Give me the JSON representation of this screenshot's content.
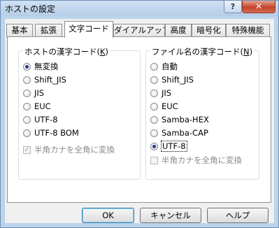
{
  "window": {
    "title": "ホストの設定",
    "help_label": "?",
    "close_label": "✕"
  },
  "tabs": [
    {
      "label": "基本"
    },
    {
      "label": "拡張"
    },
    {
      "label": "文字コード"
    },
    {
      "label": "ダイアルアップ"
    },
    {
      "label": "高度"
    },
    {
      "label": "暗号化"
    },
    {
      "label": "特殊機能"
    }
  ],
  "active_tab": "文字コード",
  "host_group": {
    "legend": "ホストの漢字コード(",
    "legend_key": "K",
    "legend_end": ")",
    "options": [
      "無変換",
      "Shift_JIS",
      "JIS",
      "EUC",
      "UTF-8",
      "UTF-8 BOM"
    ],
    "selected": "無変換",
    "checkbox": {
      "label": "半角カナを全角に変換",
      "checked": true,
      "enabled": false
    }
  },
  "filename_group": {
    "legend": "ファイル名の漢字コード(",
    "legend_key": "N",
    "legend_end": ")",
    "options": [
      "自動",
      "Shift_JIS",
      "JIS",
      "EUC",
      "Samba-HEX",
      "Samba-CAP",
      "UTF-8"
    ],
    "selected": "UTF-8",
    "checkbox": {
      "label": "半角カナを全角に変換",
      "checked": false,
      "enabled": false
    }
  },
  "buttons": {
    "ok": "OK",
    "cancel": "キャンセル",
    "help": "ヘルプ"
  },
  "colors": {
    "radio_dot": "#1f3b8f",
    "frame": "#bcd3ea",
    "close": "#c4432a"
  }
}
